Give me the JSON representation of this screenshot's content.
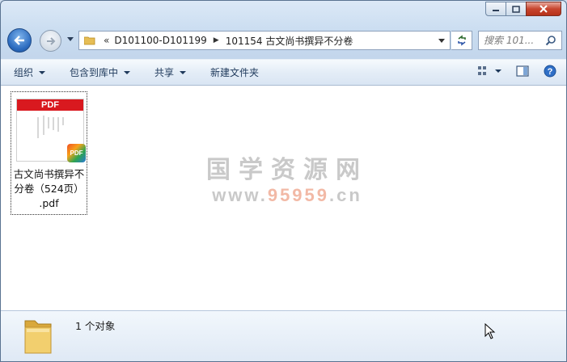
{
  "window": {
    "caption": {
      "minimize_icon": "minimize-icon",
      "maximize_icon": "maximize-icon",
      "close_icon": "close-icon"
    }
  },
  "navigation": {
    "path_prefix": "«",
    "breadcrumbs": [
      "D101100-D101199",
      "101154 古文尚书撰异不分卷"
    ],
    "search_placeholder": "搜索 101...",
    "icons": [
      "back-arrow-icon",
      "forward-arrow-icon",
      "folder-icon",
      "refresh-icon",
      "search-icon"
    ]
  },
  "toolbar": {
    "organize": "组织",
    "include_in_library": "包含到库中",
    "share": "共享",
    "new_folder": "新建文件夹",
    "right_icons": [
      "view-options-icon",
      "preview-pane-icon",
      "help-icon"
    ]
  },
  "files": [
    {
      "name_line1": "古文尚书撰异不",
      "name_line2": "分卷（524页）",
      "name_line3": ".pdf",
      "thumb_header": "PDF",
      "badge": "PDF"
    }
  ],
  "watermark": {
    "title": "国学资源网",
    "url_prefix": "www.",
    "url_highlight": "95959",
    "url_suffix": ".cn"
  },
  "status": {
    "count": "1 个对象"
  }
}
